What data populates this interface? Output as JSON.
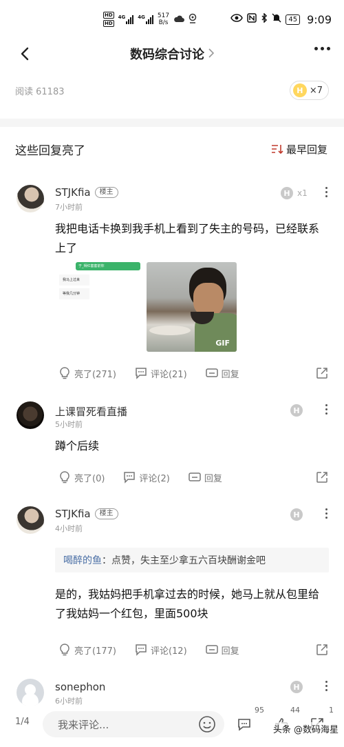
{
  "status_bar": {
    "hd1": "HD",
    "hd2": "HD",
    "sig1": "4G",
    "sig2": "4G",
    "speed_value": "517",
    "speed_unit": "B/s",
    "battery": "45",
    "time": "9:09"
  },
  "nav": {
    "title": "数码综合讨论"
  },
  "post_meta": {
    "read": "阅读 61183",
    "light_badge": "H",
    "light_count": "×7"
  },
  "section": {
    "title": "这些回复亮了",
    "sort_label": "最早回复"
  },
  "comments": [
    {
      "username": "STJKfia",
      "tag": "楼主",
      "time": "7小时前",
      "h_badge": "H",
      "light_count": "x1",
      "text": "我把电话卡换到我手机上看到了失主的号码，已经联系上了",
      "image_gif_label": "GIF",
      "chat_snippet": {
        "green": "于_得红套套前你",
        "bubble1": "我马上过来",
        "bubble2": "等我几分钟"
      },
      "likes": "亮了(271)",
      "replies": "评论(21)",
      "reply": "回复"
    },
    {
      "username": "上课冒死看直播",
      "time": "5小时前",
      "h_badge": "H",
      "text": "蹲个后续",
      "likes": "亮了(0)",
      "replies": "评论(2)",
      "reply": "回复"
    },
    {
      "username": "STJKfia",
      "tag": "楼主",
      "time": "4小时前",
      "h_badge": "H",
      "quote_name": "喝醉的鱼",
      "quote_text": "：点赞，失主至少拿五六百块酬谢金吧",
      "text": "是的，我姑妈把手机拿过去的时候，她马上就从包里给了我姑妈一个红包，里面500块",
      "likes": "亮了(177)",
      "replies": "评论(12)",
      "reply": "回复"
    },
    {
      "username": "sonephon",
      "time": "6小时前",
      "h_badge": "H"
    }
  ],
  "bottom_bar": {
    "page": "1/4",
    "input_placeholder": "我来评论...",
    "comment_count": "95",
    "like_count": "44",
    "share_count": "1",
    "watermark": "头条 @数码海星"
  }
}
